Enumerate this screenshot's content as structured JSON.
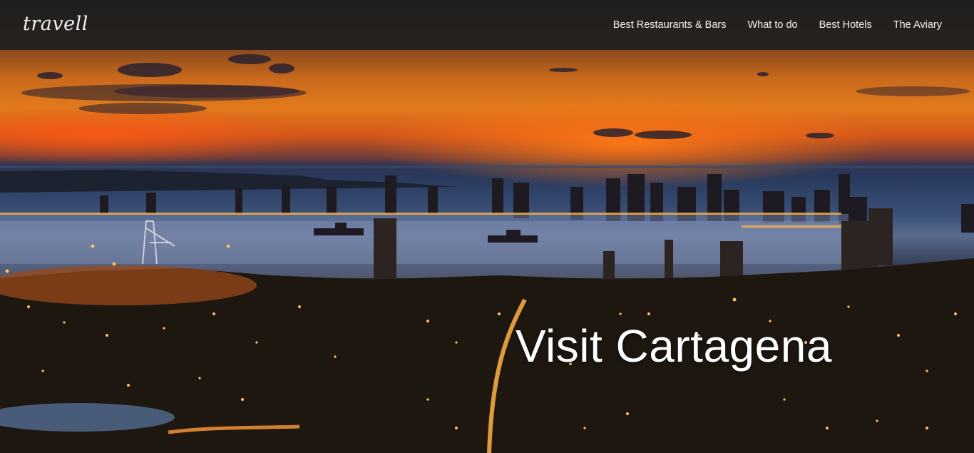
{
  "brand": {
    "logo_text": "travell"
  },
  "nav": {
    "items": [
      {
        "label": "Best Restaurants & Bars"
      },
      {
        "label": "What to do"
      },
      {
        "label": "Best Hotels"
      },
      {
        "label": "The Aviary"
      }
    ]
  },
  "hero": {
    "title": "Visit Cartagena",
    "image_subject": "Cartagena skyline at sunset over the bay"
  },
  "colors": {
    "navbar_bg": "#1e1e1e",
    "nav_text": "#f4f4f4",
    "hero_title": "#ffffff"
  }
}
